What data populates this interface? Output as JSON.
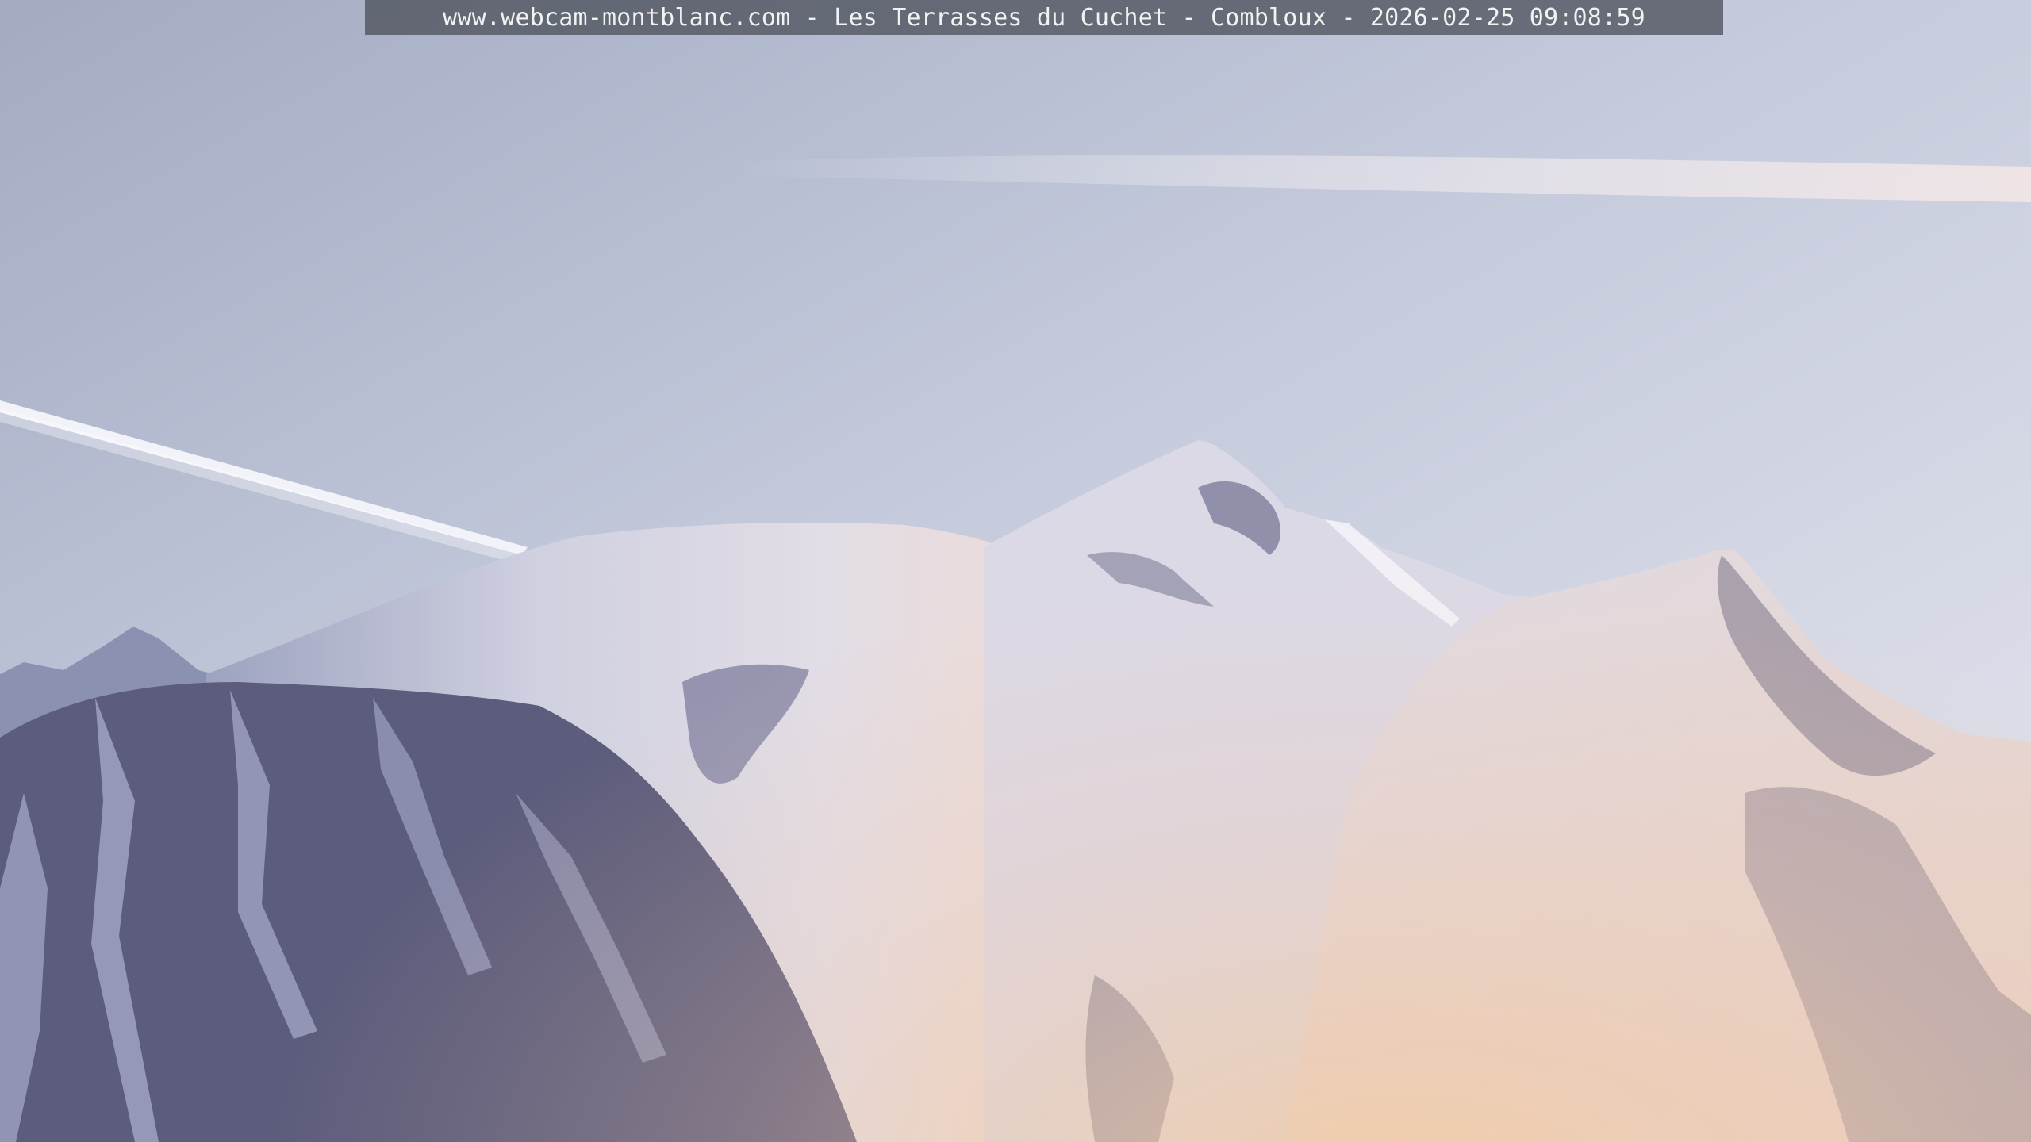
{
  "overlay": {
    "caption": "www.webcam-montblanc.com - Les Terrasses du Cuchet - Combloux - 2026-02-25 09:08:59"
  },
  "palette": {
    "sky_top": "#a9b0c6",
    "sky_horizon": "#d9dde8",
    "snow_light": "#e4e0ea",
    "snow_shadow": "#9aa0bd",
    "rock_dark": "#4a4a66",
    "warm_glare": "#f0c9a0",
    "contrail": "#f4f6fb"
  }
}
